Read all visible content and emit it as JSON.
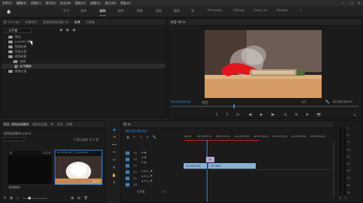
{
  "menubar": {
    "items": [
      "文件(F)",
      "编辑(E)",
      "剪辑(C)",
      "序列(S)",
      "标记(M)",
      "图形(G)",
      "视图(V)",
      "窗口(W)",
      "帮助(H)"
    ],
    "window_controls": [
      "—",
      "□",
      "✕"
    ]
  },
  "workspaces": {
    "items": [
      "学习",
      "组件",
      "编辑",
      "颜色",
      "效果",
      "音频",
      "图形",
      "库",
      "Assembly",
      "Editing",
      "Color_lut",
      "Review"
    ],
    "active_index": 2
  },
  "left_panel": {
    "tabs": [
      "源: 01.mp4",
      "效果控件",
      "音频剪辑混合器: 01",
      "效果",
      "元数据"
    ],
    "active_tab": 3,
    "search_value": "水平镜",
    "tree": [
      {
        "label": "预设",
        "depth": 0,
        "expanded": false
      },
      {
        "label": "Lumetri 预设",
        "depth": 0,
        "expanded": false
      },
      {
        "label": "音频效果",
        "depth": 0,
        "expanded": false
      },
      {
        "label": "音频过渡",
        "depth": 0,
        "expanded": false
      },
      {
        "label": "视频效果",
        "depth": 0,
        "expanded": true
      },
      {
        "label": "变换",
        "depth": 1,
        "expanded": true
      },
      {
        "label": "水平翻转",
        "depth": 2,
        "expanded": false,
        "item": true,
        "selected": true
      },
      {
        "label": "视频过渡",
        "depth": 0,
        "expanded": false
      }
    ]
  },
  "program_monitor": {
    "title": "节目: 01 ≡",
    "timecode_left": "00:00:06:02",
    "fit": "适合",
    "fraction": "1/1",
    "timecode_right": "00:00:18:07",
    "transport": [
      "{",
      "}",
      "|←",
      "◀|",
      "▶",
      "|▶",
      "→|",
      "⊕",
      "⊞",
      "📷"
    ]
  },
  "project_panel": {
    "tabs": [
      "项目: 视频连接翻转",
      "媒体浏览器",
      "库",
      "信息",
      "效果"
    ],
    "project_file": "视频连接翻转.prproj",
    "selection_info": "1 项已选择, 共 2 项",
    "thumbs": [
      {
        "label": "01",
        "duration": "15:24",
        "caption": "视频翻转"
      },
      {
        "label": "00:00:00_b0_1_20190903...",
        "duration": "18:07",
        "caption": ""
      }
    ]
  },
  "timeline": {
    "sequence_tab": "01 ≡",
    "timecode": "00:00:06:02",
    "ruler": [
      "00:00",
      "00:00:05:00",
      "00:00:10:00",
      "00:00:15:00",
      "00:00:20:00",
      "00:00:25:00",
      "00:00:30:00",
      "00:00:35:00"
    ],
    "video_tracks": [
      "V3",
      "V2",
      "V1"
    ],
    "audio_tracks": [
      "A1",
      "A2",
      "A3"
    ],
    "master": "主声道",
    "master_value": "0.0",
    "clips": [
      {
        "label": "fx",
        "track": "V2"
      },
      {
        "label": "01.mp4 [V]",
        "track": "V1"
      },
      {
        "label": "01.mp4",
        "track": "V1"
      }
    ]
  },
  "vu_meter": {
    "labels": [
      "0",
      "-6",
      "-12",
      "-18",
      "-24",
      "-30",
      "-36",
      "-42",
      "-48",
      "-54"
    ],
    "footer": [
      "S",
      "S"
    ]
  },
  "colors": {
    "accent": "#2d8ceb",
    "panel_bg": "#1b1b1b",
    "clip": "#8ab0d8"
  }
}
